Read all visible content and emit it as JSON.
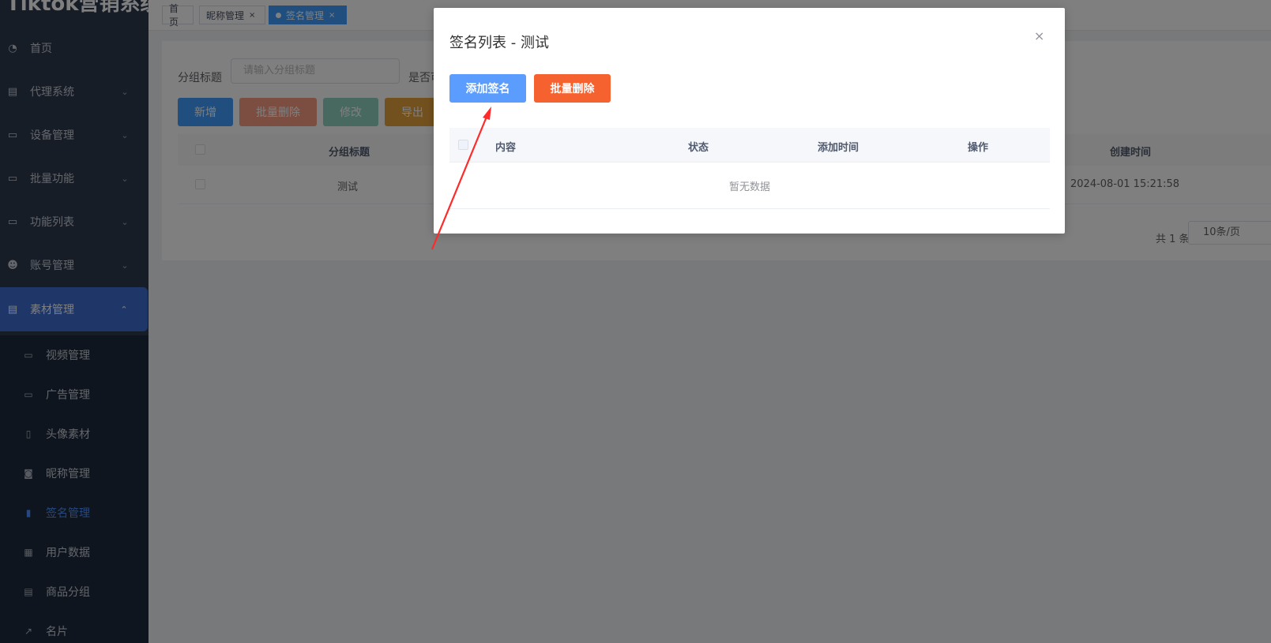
{
  "brand": "Tiktok营销系统",
  "sidebar": {
    "menu": [
      {
        "label": "首页"
      },
      {
        "label": "代理系统"
      },
      {
        "label": "设备管理"
      },
      {
        "label": "批量功能"
      },
      {
        "label": "功能列表"
      },
      {
        "label": "账号管理"
      },
      {
        "label": "素材管理"
      }
    ],
    "submenu": [
      {
        "label": "视频管理"
      },
      {
        "label": "广告管理"
      },
      {
        "label": "头像素材"
      },
      {
        "label": "昵称管理"
      },
      {
        "label": "签名管理"
      },
      {
        "label": "用户数据"
      },
      {
        "label": "商品分组"
      },
      {
        "label": "名片"
      }
    ]
  },
  "tags": [
    {
      "label": "首页"
    },
    {
      "label": "昵称管理",
      "close": "×"
    },
    {
      "label": "签名管理",
      "close": "×"
    }
  ],
  "filter": {
    "label": "分组标题",
    "placeholder": "请输入分组标题",
    "label2": "是否可"
  },
  "toolbar": {
    "add": "新增",
    "batch_delete": "批量删除",
    "edit": "修改",
    "export": "导出"
  },
  "table": {
    "headers": {
      "group_title": "分组标题",
      "created_at": "创建时间"
    },
    "rows": [
      {
        "group_title": "测试",
        "created_at": "2024-08-01 15:21:58"
      }
    ]
  },
  "pager": {
    "total": "共 1 条",
    "page_size": "10条/页"
  },
  "modal": {
    "title": "签名列表 - 测试",
    "close": "×",
    "add_btn": "添加签名",
    "batch_delete_btn": "批量删除",
    "headers": {
      "content": "内容",
      "status": "状态",
      "add_time": "添加时间",
      "actions": "操作"
    },
    "empty": "暂无数据"
  },
  "colors": {
    "sidebar_bg": "#2f3a4f",
    "submenu_bg": "#1f2a3c",
    "primary": "#409eff",
    "danger": "#f56c37",
    "arrow": "#ff2a2a"
  }
}
